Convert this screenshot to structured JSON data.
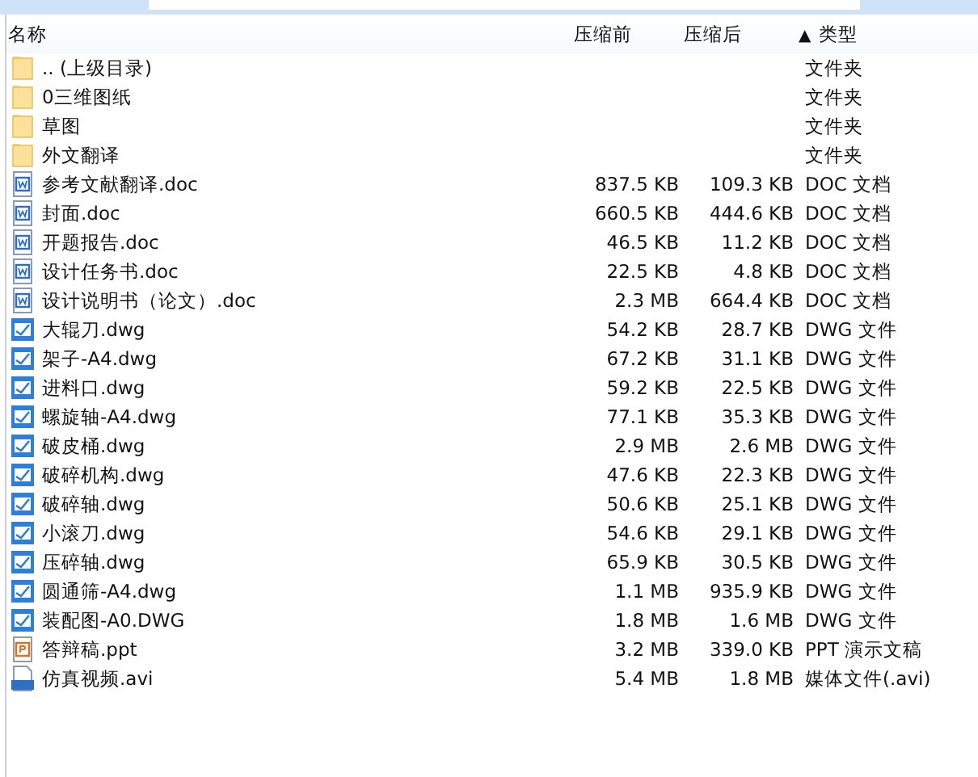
{
  "columns": [
    {
      "label": "名称"
    },
    {
      "label": "压缩前"
    },
    {
      "label": "压缩后"
    },
    {
      "label": "类型",
      "sort": "▲"
    }
  ],
  "rows": [
    {
      "kind": "folder",
      "name": ".. (上级目录)",
      "type": "文件夹"
    },
    {
      "kind": "folder",
      "name": "0三维图纸",
      "type": "文件夹"
    },
    {
      "kind": "folder",
      "name": "草图",
      "type": "文件夹"
    },
    {
      "kind": "folder",
      "name": "外文翻译",
      "type": "文件夹"
    },
    {
      "kind": "doc",
      "name": "参考文献翻译.doc",
      "size": "837.5 KB",
      "packed": "109.3 KB",
      "type": "DOC 文档"
    },
    {
      "kind": "doc",
      "name": "封面.doc",
      "size": "660.5 KB",
      "packed": "444.6 KB",
      "type": "DOC 文档"
    },
    {
      "kind": "doc",
      "name": "开题报告.doc",
      "size": "46.5 KB",
      "packed": "11.2 KB",
      "type": "DOC 文档"
    },
    {
      "kind": "doc",
      "name": "设计任务书.doc",
      "size": "22.5 KB",
      "packed": "4.8 KB",
      "type": "DOC 文档"
    },
    {
      "kind": "doc",
      "name": "设计说明书（论文）.doc",
      "size": "2.3 MB",
      "packed": "664.4 KB",
      "type": "DOC 文档"
    },
    {
      "kind": "dwg",
      "name": "大辊刀.dwg",
      "size": "54.2 KB",
      "packed": "28.7 KB",
      "type": "DWG 文件"
    },
    {
      "kind": "dwg",
      "name": "架子-A4.dwg",
      "size": "67.2 KB",
      "packed": "31.1 KB",
      "type": "DWG 文件"
    },
    {
      "kind": "dwg",
      "name": "进料口.dwg",
      "size": "59.2 KB",
      "packed": "22.5 KB",
      "type": "DWG 文件"
    },
    {
      "kind": "dwg",
      "name": "螺旋轴-A4.dwg",
      "size": "77.1 KB",
      "packed": "35.3 KB",
      "type": "DWG 文件"
    },
    {
      "kind": "dwg",
      "name": "破皮桶.dwg",
      "size": "2.9 MB",
      "packed": "2.6 MB",
      "type": "DWG 文件"
    },
    {
      "kind": "dwg",
      "name": "破碎机构.dwg",
      "size": "47.6 KB",
      "packed": "22.3 KB",
      "type": "DWG 文件"
    },
    {
      "kind": "dwg",
      "name": "破碎轴.dwg",
      "size": "50.6 KB",
      "packed": "25.1 KB",
      "type": "DWG 文件"
    },
    {
      "kind": "dwg",
      "name": "小滚刀.dwg",
      "size": "54.6 KB",
      "packed": "29.1 KB",
      "type": "DWG 文件"
    },
    {
      "kind": "dwg",
      "name": "压碎轴.dwg",
      "size": "65.9 KB",
      "packed": "30.5 KB",
      "type": "DWG 文件"
    },
    {
      "kind": "dwg",
      "name": "圆通筛-A4.dwg",
      "size": "1.1 MB",
      "packed": "935.9 KB",
      "type": "DWG 文件"
    },
    {
      "kind": "dwg",
      "name": "装配图-A0.DWG",
      "size": "1.8 MB",
      "packed": "1.6 MB",
      "type": "DWG 文件"
    },
    {
      "kind": "ppt",
      "name": "答辩稿.ppt",
      "size": "3.2 MB",
      "packed": "339.0 KB",
      "type": "PPT 演示文稿"
    },
    {
      "kind": "avi",
      "name": "仿真视频.avi",
      "size": "5.4 MB",
      "packed": "1.8 MB",
      "type": "媒体文件(.avi)"
    }
  ]
}
